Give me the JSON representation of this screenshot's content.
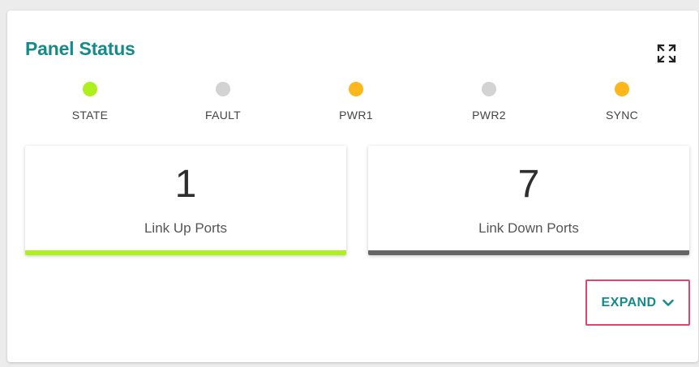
{
  "panel": {
    "title": "Panel Status",
    "fullscreen_icon": "fullscreen-icon"
  },
  "leds": [
    {
      "label": "STATE",
      "color": "#aef01e"
    },
    {
      "label": "FAULT",
      "color": "#d3d3d3"
    },
    {
      "label": "PWR1",
      "color": "#fbb71c"
    },
    {
      "label": "PWR2",
      "color": "#d3d3d3"
    },
    {
      "label": "SYNC",
      "color": "#fbb71c"
    }
  ],
  "stats": {
    "link_up": {
      "value": "1",
      "label": "Link Up Ports",
      "color": "#aef01e"
    },
    "link_down": {
      "value": "7",
      "label": "Link Down Ports",
      "color": "#666666"
    }
  },
  "expand": {
    "label": "EXPAND",
    "icon": "chevron-down-icon"
  },
  "colors": {
    "accent": "#158a8a",
    "highlight_border": "#e0456b"
  }
}
